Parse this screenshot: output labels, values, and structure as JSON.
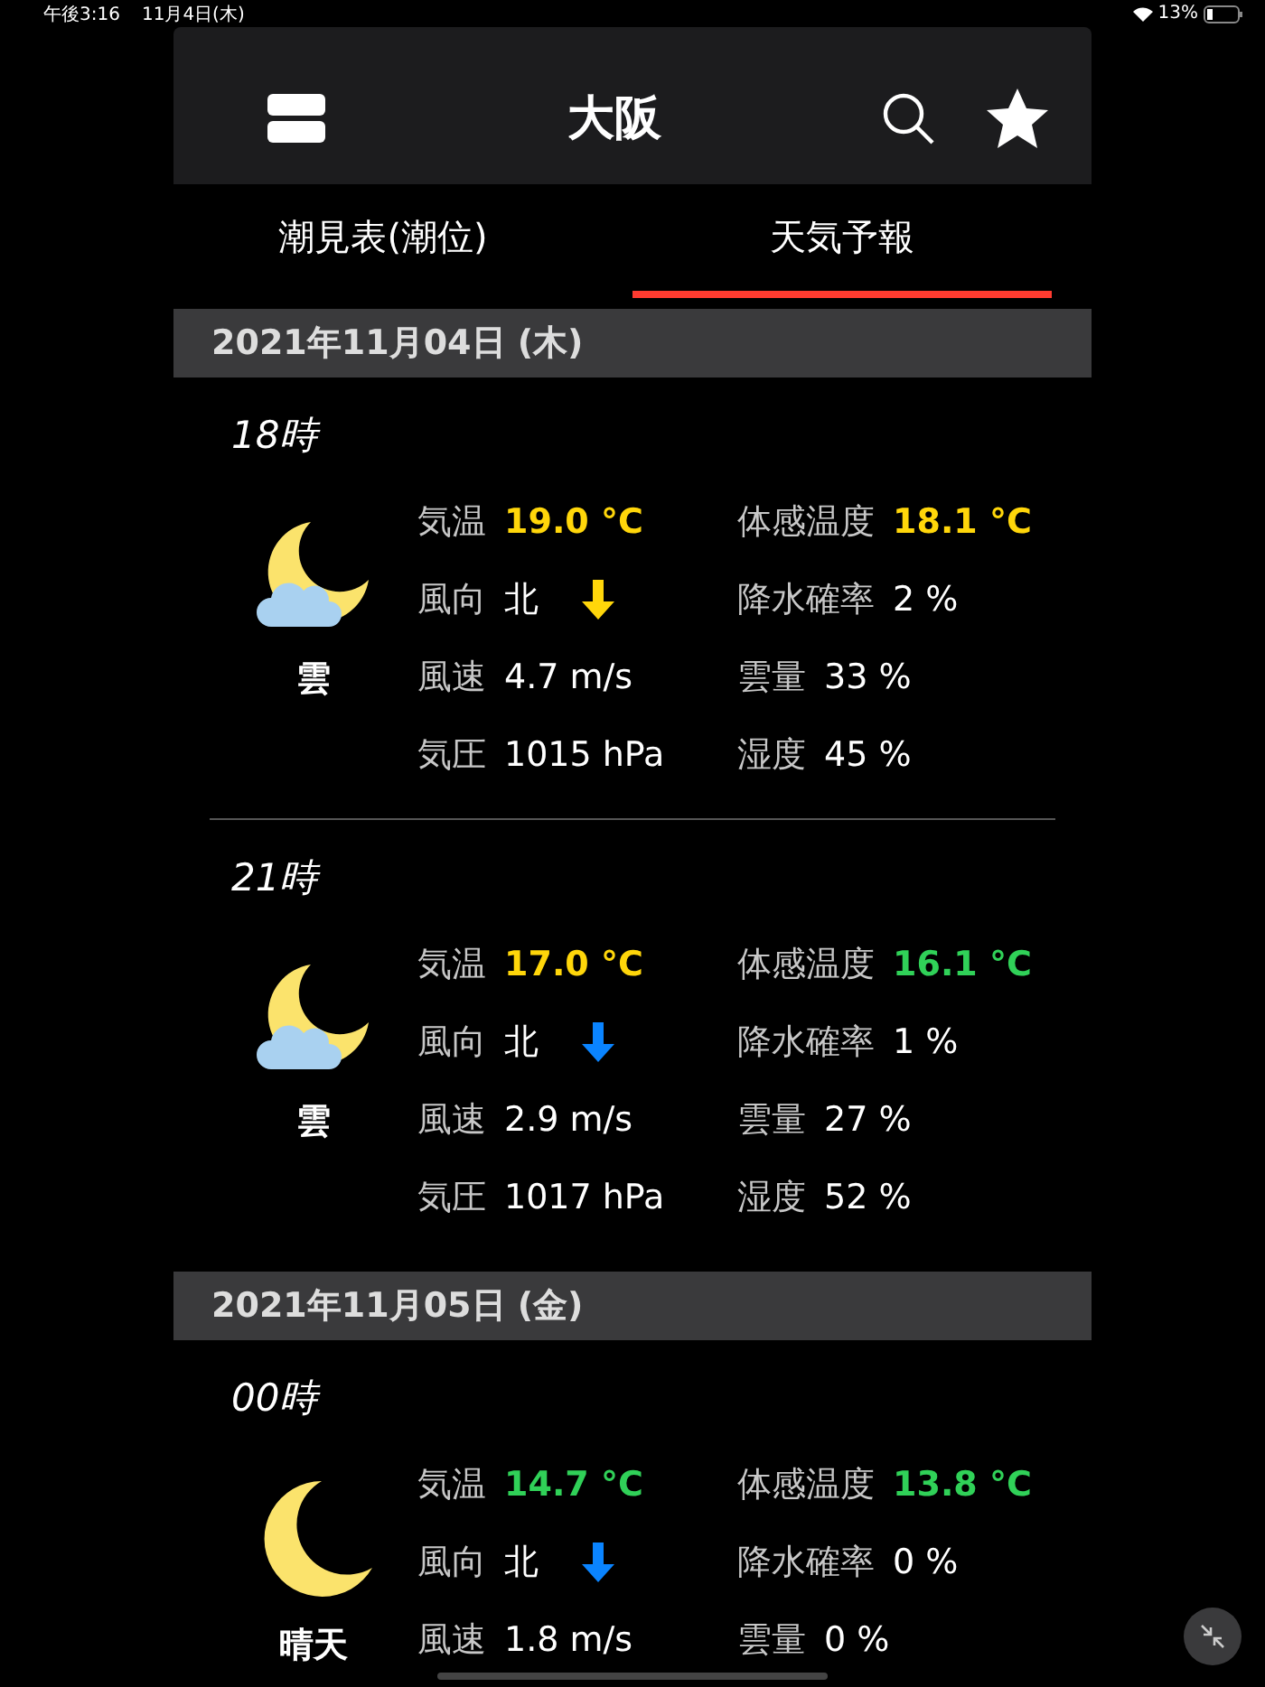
{
  "status_bar": {
    "time": "午後3:16",
    "date": "11月4日(木)",
    "battery": "13%"
  },
  "header": {
    "title": "大阪"
  },
  "tabs": [
    {
      "label": "潮見表(潮位)",
      "selected": false
    },
    {
      "label": "天気予報",
      "selected": true
    }
  ],
  "days": [
    {
      "date": "2021年11月04日 (木)",
      "hours": [
        {
          "time": "18時",
          "kind": "cloudy",
          "condition": "雲",
          "temp_label": "気温",
          "temp": {
            "text": "19.0 °C",
            "color": "#ffd60a"
          },
          "feels_label": "体感温度",
          "feels": {
            "text": "18.1 °C",
            "color": "#ffd60a"
          },
          "wind_dir_label": "風向",
          "wind_dir": "北",
          "wind_arrow": {
            "color": "#ffd60a"
          },
          "rain_label": "降水確率",
          "rain": "2 %",
          "wind_label": "風速",
          "wind": "4.7 m/s",
          "cloud_label": "雲量",
          "cloud": "33 %",
          "pressure_label": "気圧",
          "pressure": "1015 hPa",
          "humidity_label": "湿度",
          "humidity": "45 %"
        },
        {
          "time": "21時",
          "kind": "cloudy",
          "condition": "雲",
          "temp_label": "気温",
          "temp": {
            "text": "17.0 °C",
            "color": "#ffd60a"
          },
          "feels_label": "体感温度",
          "feels": {
            "text": "16.1 °C",
            "color": "#30d158"
          },
          "wind_dir_label": "風向",
          "wind_dir": "北",
          "wind_arrow": {
            "color": "#0a84ff"
          },
          "rain_label": "降水確率",
          "rain": "1 %",
          "wind_label": "風速",
          "wind": "2.9 m/s",
          "cloud_label": "雲量",
          "cloud": "27 %",
          "pressure_label": "気圧",
          "pressure": "1017 hPa",
          "humidity_label": "湿度",
          "humidity": "52 %"
        }
      ]
    },
    {
      "date": "2021年11月05日 (金)",
      "hours": [
        {
          "time": "00時",
          "kind": "clear",
          "condition": "晴天",
          "temp_label": "気温",
          "temp": {
            "text": "14.7 °C",
            "color": "#30d158"
          },
          "feels_label": "体感温度",
          "feels": {
            "text": "13.8 °C",
            "color": "#30d158"
          },
          "wind_dir_label": "風向",
          "wind_dir": "北",
          "wind_arrow": {
            "color": "#0a84ff"
          },
          "rain_label": "降水確率",
          "rain": "0 %",
          "wind_label": "風速",
          "wind": "1.8 m/s",
          "cloud_label": "雲量",
          "cloud": "0 %"
        }
      ]
    }
  ]
}
